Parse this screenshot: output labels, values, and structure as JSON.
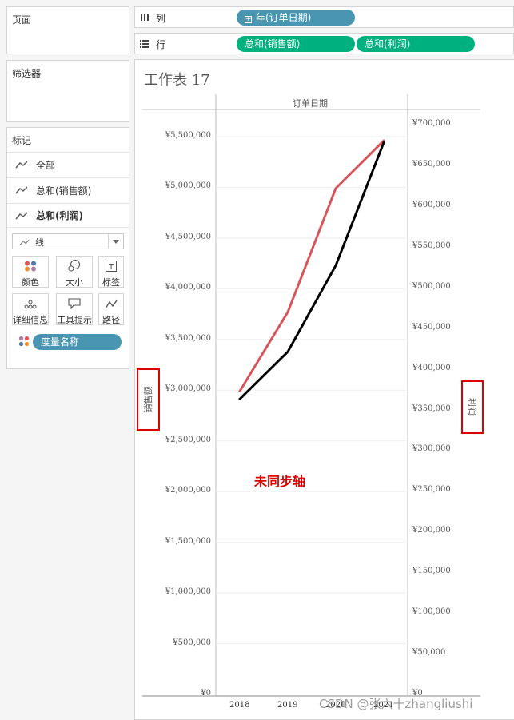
{
  "left_panel": {
    "pages_title": "页面",
    "filters_title": "筛选器",
    "marks_title": "标记",
    "mark_cards": [
      {
        "label": "全部",
        "active": false
      },
      {
        "label": "总和(销售额)",
        "active": false
      },
      {
        "label": "总和(利润)",
        "active": true
      }
    ],
    "mark_type": "线",
    "mark_buttons": {
      "color": "颜色",
      "size": "大小",
      "label": "标签",
      "detail": "详细信息",
      "tooltip": "工具提示",
      "path": "路径"
    },
    "measure_pill": "度量名称"
  },
  "shelves": {
    "columns_label": "列",
    "columns_pill": "年(订单日期)",
    "rows_label": "行",
    "rows_pills": [
      "总和(销售额)",
      "总和(利润)"
    ]
  },
  "colors": {
    "dimension_pill": "#4996b2",
    "measure_pill": "#00b180",
    "sales_line": "#d6555a",
    "profit_line": "#000000",
    "annotation_red": "#e00000"
  },
  "worksheet": {
    "title": "工作表  17",
    "header": "订单日期",
    "annotation": "未同步轴",
    "watermark": "CSDN @张六十zhangliushi"
  },
  "chart_data": {
    "type": "line",
    "categories": [
      "2018",
      "2019",
      "2020",
      "2021"
    ],
    "left_axis": {
      "label": "销售额",
      "range": [
        0,
        5650000
      ],
      "ticks": [
        "¥0",
        "¥500,000",
        "¥1,000,000",
        "¥1,500,000",
        "¥2,000,000",
        "¥2,500,000",
        "¥3,000,000",
        "¥3,500,000",
        "¥4,000,000",
        "¥4,500,000",
        "¥5,000,000",
        "¥5,500,000"
      ],
      "tick_values": [
        0,
        500000,
        1000000,
        1500000,
        2000000,
        2500000,
        3000000,
        3500000,
        4000000,
        4500000,
        5000000,
        5500000
      ]
    },
    "right_axis": {
      "label": "利润",
      "range": [
        0,
        712000
      ],
      "ticks": [
        "¥0",
        "¥50,000",
        "¥100,000",
        "¥150,000",
        "¥200,000",
        "¥250,000",
        "¥300,000",
        "¥350,000",
        "¥400,000",
        "¥450,000",
        "¥500,000",
        "¥550,000",
        "¥600,000",
        "¥650,000",
        "¥700,000"
      ],
      "tick_values": [
        0,
        50000,
        100000,
        150000,
        200000,
        250000,
        300000,
        350000,
        400000,
        450000,
        500000,
        550000,
        600000,
        650000,
        700000
      ]
    },
    "series": [
      {
        "name": "总和(销售额)",
        "axis": "left",
        "values": [
          2990000,
          3770000,
          4990000,
          5460000
        ]
      },
      {
        "name": "总和(利润)",
        "axis": "right",
        "values": [
          363000,
          421000,
          527000,
          678000
        ]
      }
    ],
    "grid": true
  }
}
